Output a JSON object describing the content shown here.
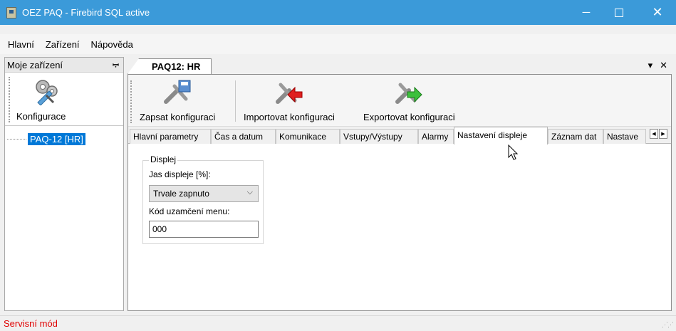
{
  "window": {
    "title": "OEZ PAQ - Firebird SQL active"
  },
  "menu": [
    "Hlavní",
    "Zařízení",
    "Nápověda"
  ],
  "left_panel": {
    "header": "Moje zařízení",
    "config_label": "Konfigurace",
    "tree_item": "PAQ-12 [HR]"
  },
  "document": {
    "tab_title": "PAQ12: HR",
    "toolbar": {
      "write_label": "Zapsat konfiguraci",
      "import_label": "Importovat konfiguraci",
      "export_label": "Exportovat konfiguraci"
    },
    "tabs": [
      "Hlavní parametry",
      "Čas a datum",
      "Komunikace",
      "Vstupy/Výstupy",
      "Alarmy",
      "Nastavení displeje",
      "Záznam dat",
      "Nastave"
    ],
    "active_tab": "Nastavení displeje",
    "display_group": {
      "title": "Displej",
      "brightness_label": "Jas displeje [%]:",
      "brightness_value": "Trvale zapnuto",
      "lock_label": "Kód uzamčení menu:",
      "lock_value": "000"
    }
  },
  "status": {
    "text": "Servisní mód"
  },
  "colors": {
    "titlebar": "#3b9ad9",
    "selection": "#0078d7",
    "status_text": "#e00000"
  }
}
